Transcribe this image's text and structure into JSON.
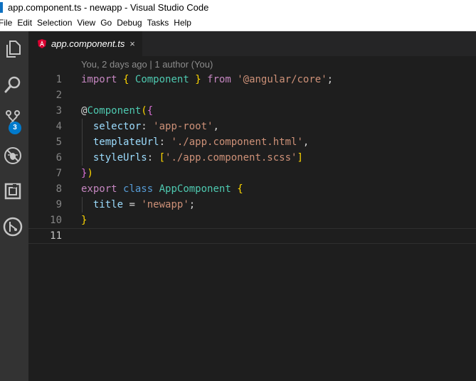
{
  "window": {
    "title": "app.component.ts - newapp - Visual Studio Code"
  },
  "menu": {
    "items": [
      "File",
      "Edit",
      "Selection",
      "View",
      "Go",
      "Debug",
      "Tasks",
      "Help"
    ]
  },
  "activity_bar": {
    "icons": [
      "explorer-icon",
      "search-icon",
      "source-control-icon",
      "debug-icon",
      "extensions-icon",
      "gitlens-icon"
    ],
    "source_control_badge": "3"
  },
  "tab": {
    "label": "app.component.ts",
    "close_glyph": "×",
    "icon": "angular-icon"
  },
  "blame": {
    "text": "You, 2 days ago | 1 author (You)"
  },
  "editor": {
    "active_line": 11,
    "line_numbers": [
      "1",
      "2",
      "3",
      "4",
      "5",
      "6",
      "7",
      "8",
      "9",
      "10",
      "11"
    ],
    "lines": [
      "import { Component } from '@angular/core';",
      "",
      "@Component({",
      "  selector: 'app-root',",
      "  templateUrl: './app.component.html',",
      "  styleUrls: ['./app.component.scss']",
      "})",
      "export class AppComponent {",
      "  title = 'newapp';",
      "}",
      ""
    ]
  },
  "colors": {
    "accent": "#007acc",
    "activity_bar": "#333333",
    "editor_bg": "#1e1e1e",
    "angular_red": "#dd0031"
  }
}
